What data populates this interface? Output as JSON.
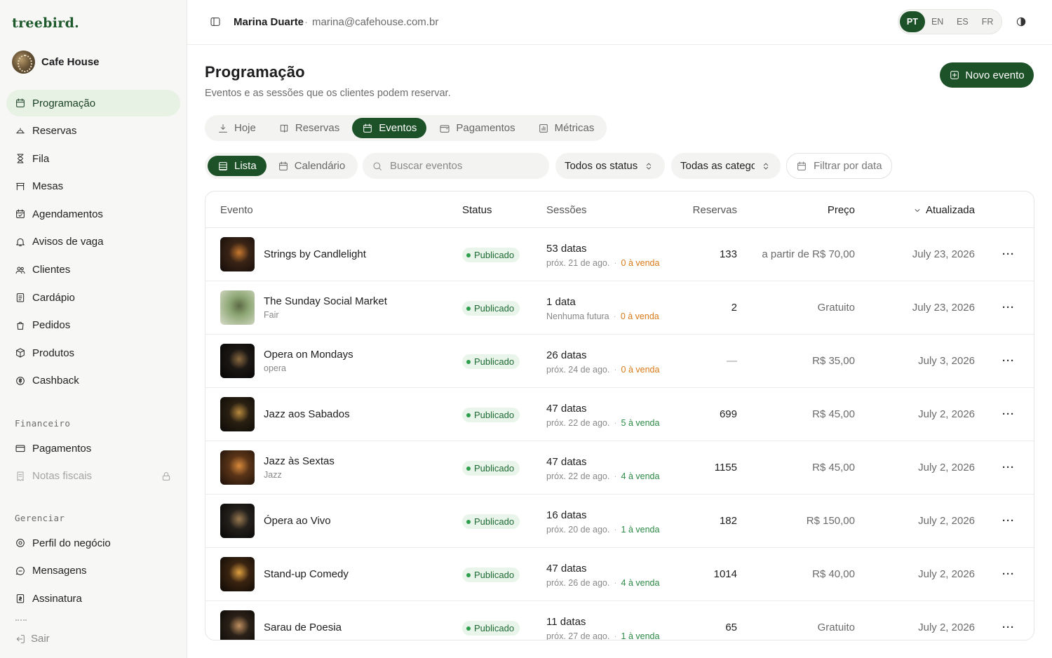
{
  "sidebar": {
    "logo": "treebird.",
    "business_name": "Cafe House",
    "main_items": [
      {
        "label": "Programação",
        "icon": "calendar-icon"
      },
      {
        "label": "Reservas",
        "icon": "reservation-icon"
      },
      {
        "label": "Fila",
        "icon": "hourglass-icon"
      },
      {
        "label": "Mesas",
        "icon": "table-icon"
      },
      {
        "label": "Agendamentos",
        "icon": "calendar-check-icon"
      },
      {
        "label": "Avisos de vaga",
        "icon": "bell-icon"
      },
      {
        "label": "Clientes",
        "icon": "users-icon"
      },
      {
        "label": "Cardápio",
        "icon": "menu-icon"
      },
      {
        "label": "Pedidos",
        "icon": "shopping-bag-icon"
      },
      {
        "label": "Produtos",
        "icon": "box-icon"
      },
      {
        "label": "Cashback",
        "icon": "cashback-icon"
      }
    ],
    "financeiro_title": "Financeiro",
    "financeiro_items": [
      {
        "label": "Pagamentos",
        "icon": "card-icon"
      },
      {
        "label": "Notas fiscais",
        "icon": "receipt-icon"
      }
    ],
    "gerenciar_title": "Gerenciar",
    "gerenciar_items": [
      {
        "label": "Perfil do negócio",
        "icon": "location-icon"
      },
      {
        "label": "Mensagens",
        "icon": "chat-icon"
      },
      {
        "label": "Assinatura",
        "icon": "subscription-icon"
      }
    ],
    "signout": "Sair"
  },
  "topbar": {
    "user_name": "Marina Duarte",
    "separator": "·",
    "user_email": "marina@cafehouse.com.br",
    "languages": [
      "PT",
      "EN",
      "ES",
      "FR"
    ],
    "active_language": "PT"
  },
  "page": {
    "title": "Programação",
    "subtitle": "Eventos e as sessões que os clientes podem reservar.",
    "new_button": "Novo evento"
  },
  "tabs": [
    "Hoje",
    "Reservas",
    "Eventos",
    "Pagamentos",
    "Métricas"
  ],
  "active_tab": "Eventos",
  "toolbar": {
    "view_list": "Lista",
    "view_calendar": "Calendário",
    "search_placeholder": "Buscar eventos",
    "status_filter": "Todos os status",
    "category_filter": "Todas as categorias",
    "date_filter": "Filtrar por data"
  },
  "table": {
    "headers": {
      "event": "Evento",
      "status": "Status",
      "sessions": "Sessões",
      "reservations": "Reservas",
      "price": "Preço",
      "updated": "Atualizada"
    },
    "rows": [
      {
        "title": "Strings by Candlelight",
        "subtitle": "",
        "status": "Publicado",
        "sessions": "53 datas",
        "next": "próx. 21 de ago.",
        "on_sale": "0 à venda",
        "sale_tone": "orange",
        "reservations": "133",
        "price": "a partir de R$ 70,00",
        "updated": "July 23, 2026",
        "thumb": [
          "#3a2416",
          "#120b08",
          "#c7782e"
        ]
      },
      {
        "title": "The Sunday Social Market",
        "subtitle": "Fair",
        "status": "Publicado",
        "sessions": "1 data",
        "next": "Nenhuma futura",
        "on_sale": "0 à venda",
        "sale_tone": "orange",
        "reservations": "2",
        "price": "Gratuito",
        "updated": "July 23, 2026",
        "thumb": [
          "#8fa876",
          "#d8dccb",
          "#5d6b45"
        ]
      },
      {
        "title": "Opera on Mondays",
        "subtitle": "opera",
        "status": "Publicado",
        "sessions": "26 datas",
        "next": "próx. 24 de ago.",
        "on_sale": "0 à venda",
        "sale_tone": "orange",
        "reservations": "—",
        "price": "R$ 35,00",
        "updated": "July 3, 2026",
        "thumb": [
          "#1b1714",
          "#050505",
          "#8a6a40"
        ]
      },
      {
        "title": "Jazz aos Sabados",
        "subtitle": "",
        "status": "Publicado",
        "sessions": "47 datas",
        "next": "próx. 22 de ago.",
        "on_sale": "5 à venda",
        "sale_tone": "green",
        "reservations": "699",
        "price": "R$ 45,00",
        "updated": "July 2, 2026",
        "thumb": [
          "#2a2012",
          "#0a0806",
          "#b88a3e"
        ]
      },
      {
        "title": "Jazz às Sextas",
        "subtitle": "Jazz",
        "status": "Publicado",
        "sessions": "47 datas",
        "next": "próx. 22 de ago.",
        "on_sale": "4 à venda",
        "sale_tone": "green",
        "reservations": "1155",
        "price": "R$ 45,00",
        "updated": "July 2, 2026",
        "thumb": [
          "#5a3418",
          "#1a0f08",
          "#d88a3a"
        ]
      },
      {
        "title": "Ópera ao Vivo",
        "subtitle": "",
        "status": "Publicado",
        "sessions": "16 datas",
        "next": "próx. 20 de ago.",
        "on_sale": "1 à venda",
        "sale_tone": "green",
        "reservations": "182",
        "price": "R$ 150,00",
        "updated": "July 2, 2026",
        "thumb": [
          "#24201c",
          "#060606",
          "#9a7a50"
        ]
      },
      {
        "title": "Stand-up Comedy",
        "subtitle": "",
        "status": "Publicado",
        "sessions": "47 datas",
        "next": "próx. 26 de ago.",
        "on_sale": "4 à venda",
        "sale_tone": "green",
        "reservations": "1014",
        "price": "R$ 40,00",
        "updated": "July 2, 2026",
        "thumb": [
          "#3a2410",
          "#0c0805",
          "#e0a040"
        ]
      },
      {
        "title": "Sarau de Poesia",
        "subtitle": "",
        "status": "Publicado",
        "sessions": "11 datas",
        "next": "próx. 27 de ago.",
        "on_sale": "1 à venda",
        "sale_tone": "green",
        "reservations": "65",
        "price": "Gratuito",
        "updated": "July 2, 2026",
        "thumb": [
          "#2b2118",
          "#080604",
          "#c09060"
        ]
      }
    ]
  },
  "colors": {
    "primary": "#1d5128",
    "active_nav_bg": "#e7f1e4",
    "badge_bg": "#e9f4ea",
    "badge_text": "#1e6b33",
    "sale_orange": "#d97a16",
    "sale_green": "#2b8a45"
  }
}
